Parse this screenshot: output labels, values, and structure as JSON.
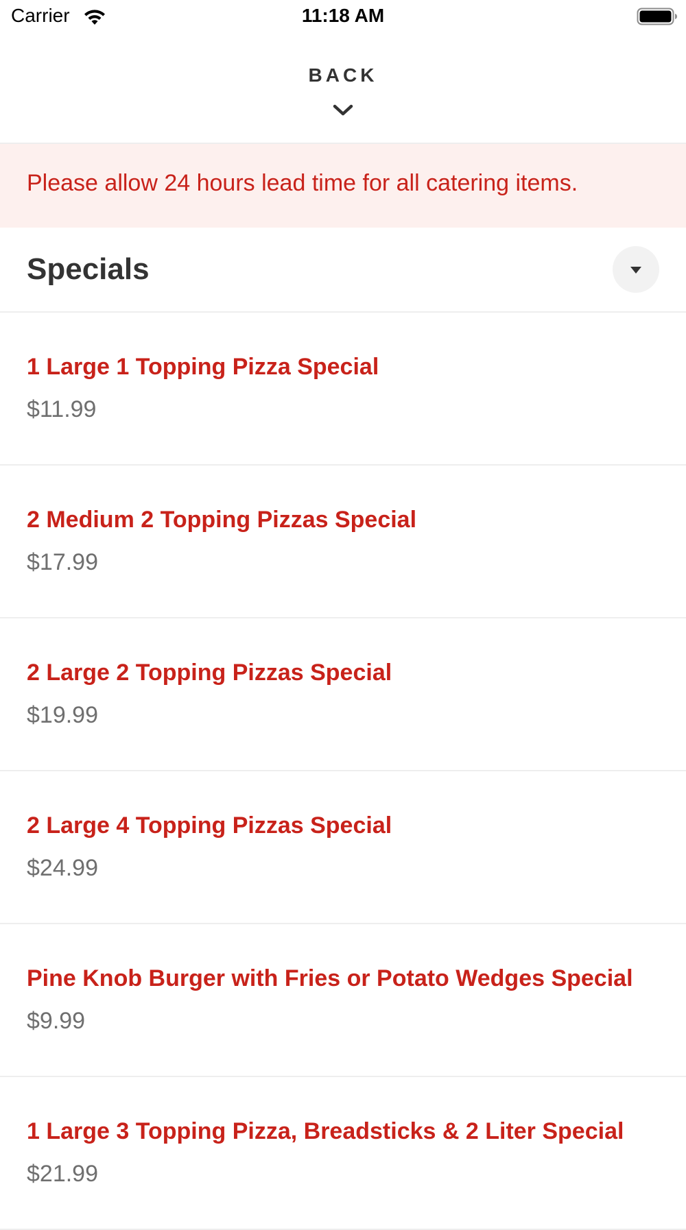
{
  "status_bar": {
    "carrier": "Carrier",
    "time": "11:18 AM",
    "wifi_icon": "wifi-icon",
    "battery_icon": "battery-icon"
  },
  "header": {
    "back_label": "BACK",
    "back_icon": "chevron-down-icon"
  },
  "notice": {
    "text": "Please allow 24 hours lead time for all catering items.",
    "background": "#fdf0ee",
    "color": "#c8221a"
  },
  "section": {
    "title": "Specials",
    "toggle_icon": "caret-down-icon"
  },
  "items": [
    {
      "name": "1 Large 1 Topping Pizza Special",
      "price": "$11.99"
    },
    {
      "name": "2 Medium 2 Topping Pizzas Special",
      "price": "$17.99"
    },
    {
      "name": "2 Large 2 Topping Pizzas Special",
      "price": "$19.99"
    },
    {
      "name": "2 Large 4 Topping Pizzas Special",
      "price": "$24.99"
    },
    {
      "name": "Pine Knob Burger with Fries or Potato Wedges Special",
      "price": "$9.99"
    },
    {
      "name": "1 Large 3 Topping Pizza, Breadsticks & 2 Liter Special",
      "price": "$21.99"
    }
  ],
  "colors": {
    "accent": "#c8221a",
    "price": "#6f6f6f",
    "divider": "#eeeeee"
  }
}
